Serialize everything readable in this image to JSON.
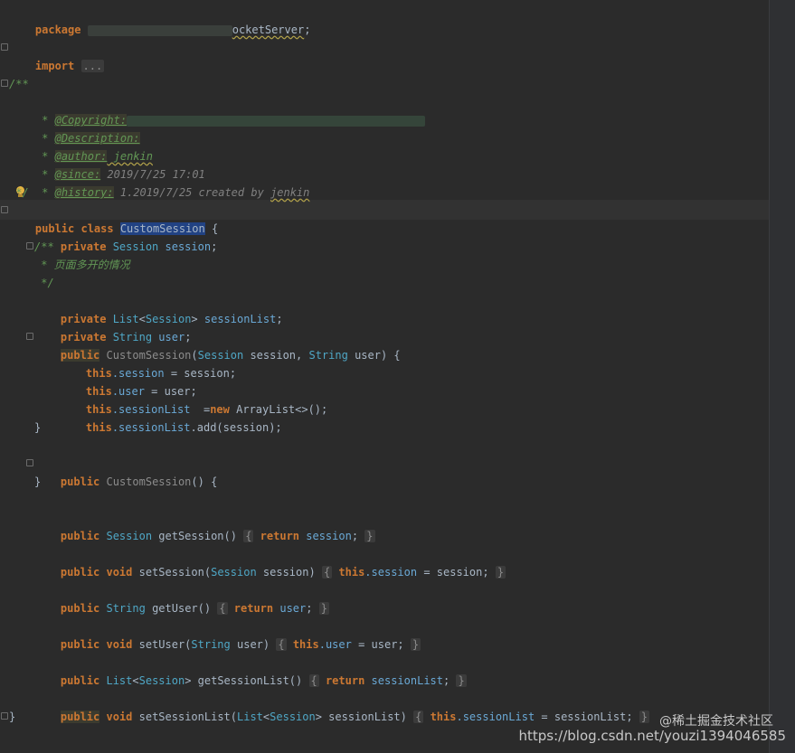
{
  "lines": {
    "package": {
      "kw": "package",
      "name_tail": "ocketServer",
      "end": ";"
    },
    "import": {
      "kw": "import",
      "collapsed": "..."
    },
    "doc_open": "/**",
    "copyright": {
      "prefix": " * ",
      "tag": "@Copyright:"
    },
    "description": {
      "prefix": " * ",
      "tag": "@Description:"
    },
    "author": {
      "prefix": " * ",
      "tag": "@author:",
      "value": " jenkin"
    },
    "since": {
      "prefix": " * ",
      "tag": "@since:",
      "value": " 2019/7/25 17:01"
    },
    "history": {
      "prefix": " * ",
      "tag": "@history:",
      "value": " 1.2019/7/25 created by ",
      "value2": "jenkin"
    },
    "doc_close": " */",
    "class_decl": {
      "kw": "public class ",
      "name": "CustomSession",
      "end": " {"
    },
    "field_session": {
      "kw": "private ",
      "type": "Session ",
      "name": "session",
      "end": ";"
    },
    "c_open": "/**",
    "c_body": " * 页面多开的情况",
    "c_close": " */",
    "field_list": {
      "kw": "private ",
      "type": "List",
      "lt": "<",
      "type2": "Session",
      "gt": "> ",
      "name": "sessionList",
      "end": ";"
    },
    "field_user": {
      "kw": "private ",
      "type": "String ",
      "name": "user",
      "end": ";"
    },
    "ctor": {
      "kw": "public",
      "name": " CustomSession",
      "p1": "(",
      "t1": "Session",
      "a1": " session, ",
      "t2": "String",
      "a2": " user) {"
    },
    "ctor_b1": {
      "kw": "this",
      "f": ".session",
      "rest": " = session;"
    },
    "ctor_b2": {
      "kw": "this",
      "f": ".user",
      "rest": " = user;"
    },
    "ctor_b3": {
      "kw": "this",
      "f": ".sessionList",
      "rest": "  =",
      "kw2": "new",
      "rest2": " ArrayList<>();"
    },
    "ctor_b4": {
      "kw": "this",
      "f": ".sessionList",
      "rest": ".add(session);"
    },
    "ctor_close": "}",
    "ctor2": {
      "kw": "public",
      "name": " CustomSession",
      "rest": "() {"
    },
    "ctor2_close": "}",
    "getSession": {
      "kw": "public ",
      "type": "Session",
      "name": " getSession()",
      "ob": "{",
      "ret": " return ",
      "f": "session",
      "semi": ";",
      "cb": "}"
    },
    "setSession": {
      "kw": "public void ",
      "name": "setSession(",
      "type": "Session",
      "rest": " session)",
      "ob": "{",
      "this": " this",
      "f": ".session",
      "rest2": " = session;",
      "cb": "}"
    },
    "getUser": {
      "kw": "public ",
      "type": "String",
      "name": " getUser()",
      "ob": "{",
      "ret": " return ",
      "f": "user",
      "semi": ";",
      "cb": "}"
    },
    "setUser": {
      "kw": "public void ",
      "name": "setUser(",
      "type": "String",
      "rest": " user)",
      "ob": "{",
      "this": " this",
      "f": ".user",
      "rest2": " = user;",
      "cb": "}"
    },
    "getSessionList": {
      "kw": "public ",
      "type": "List",
      "lt": "<",
      "type2": "Session",
      "gt": ">",
      "name": " getSessionList()",
      "ob": "{",
      "ret": " return ",
      "f": "sessionList",
      "semi": ";",
      "cb": "}"
    },
    "setSessionList": {
      "kw": "public",
      "kw2": " void ",
      "name": "setSessionList(",
      "type": "List",
      "lt": "<",
      "type2": "Session",
      "gt": ">",
      "rest": " sessionList)",
      "ob": "{",
      "this": " this",
      "f": ".sessionList",
      "rest2": " = sessionList;",
      "cb": "}"
    },
    "class_close": "}"
  },
  "watermark": {
    "line1": "@稀土掘金技术社区",
    "line2": "https://blog.csdn.net/youzi1394046585"
  },
  "icons": {
    "hint": "lightbulb-icon"
  },
  "colors": {
    "background": "#2b2b2b",
    "keyword": "#cc7832",
    "comment": "#629755",
    "field": "#6aa9d6",
    "type": "#4fa7c6"
  }
}
